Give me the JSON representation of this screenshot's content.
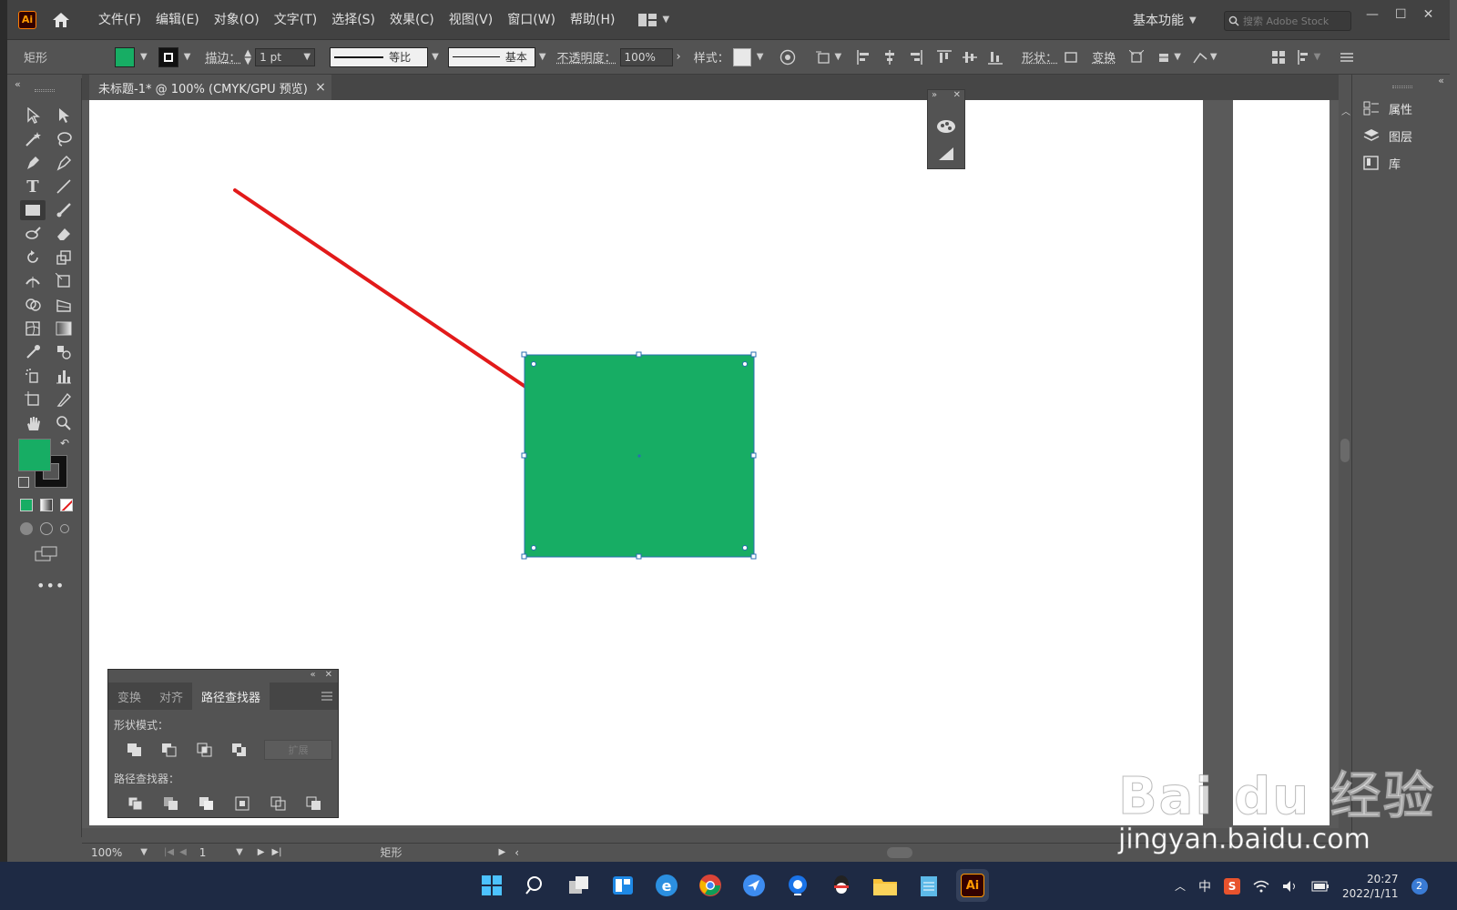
{
  "app": {
    "logo_text": "Ai",
    "menus": [
      "文件(F)",
      "编辑(E)",
      "对象(O)",
      "文字(T)",
      "选择(S)",
      "效果(C)",
      "视图(V)",
      "窗口(W)",
      "帮助(H)"
    ],
    "workspace": "基本功能",
    "stock_placeholder": "搜索 Adobe Stock"
  },
  "controlbar": {
    "object_type": "矩形",
    "fill_color": "#17ad64",
    "stroke_label": "描边：",
    "stroke_weight": "1 pt",
    "stroke_profile": "等比",
    "brush": "基本",
    "opacity_label": "不透明度：",
    "opacity_value": "100%",
    "style_label": "样式：",
    "shape_label": "形状：",
    "transform_label": "变换"
  },
  "document": {
    "tab_title": "未标题-1* @ 100% (CMYK/GPU 预览)"
  },
  "canvas": {
    "rect_color": "#17ad64",
    "arrow_color": "#e21a1a"
  },
  "pathfinder": {
    "tabs": [
      "变换",
      "对齐",
      "路径查找器"
    ],
    "active_tab": 2,
    "shape_modes_label": "形状模式：",
    "pathfinders_label": "路径查找器：",
    "expand_label": "扩展"
  },
  "rightpanel": {
    "items": [
      "属性",
      "图层",
      "库"
    ]
  },
  "statusbar": {
    "zoom": "100%",
    "artboard_num": "1",
    "tool_name": "矩形"
  },
  "taskbar": {
    "ime": "中",
    "time": "20:27",
    "date": "2022/1/11",
    "notifications": "2"
  },
  "watermark": {
    "brand": "Bai du 经验",
    "url": "jingyan.baidu.com"
  }
}
